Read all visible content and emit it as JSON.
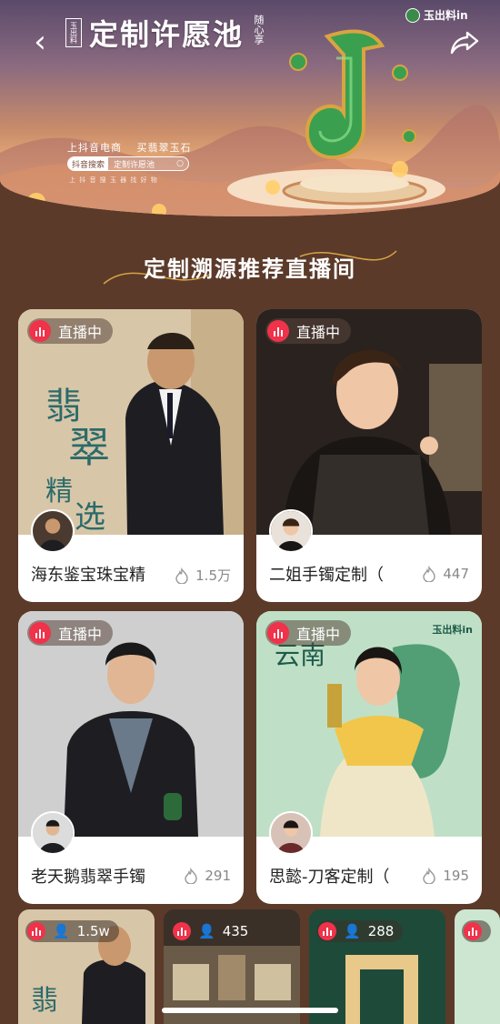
{
  "banner": {
    "seal_text": "玉出料",
    "title": "定制许愿池",
    "subtitle": "随心享",
    "brand": "玉出料in",
    "slogan_left": "上抖音电商",
    "slogan_right": "买翡翠玉石",
    "search_tag": "抖音搜索",
    "search_query": "定制许愿池",
    "fine_print": "上 抖 音   搜 玉 器 找 好 物"
  },
  "section": {
    "title": "定制溯源推荐直播间"
  },
  "live_label": "直播中",
  "cards": [
    {
      "name": "海东鉴宝珠宝精",
      "likes": "1.5万",
      "photo_text": "翡翠精选"
    },
    {
      "name": "二姐手镯定制（",
      "likes": "447"
    },
    {
      "name": "老天鹅翡翠手镯",
      "likes": "291"
    },
    {
      "name": "思懿-刀客定制（",
      "likes": "195",
      "photo_text": "云南",
      "brand": "玉出料in"
    }
  ],
  "bottom_strip": [
    {
      "viewers": "1.5w"
    },
    {
      "viewers": "435"
    },
    {
      "viewers": "288"
    },
    {
      "viewers": ""
    }
  ],
  "colors": {
    "background": "#5b3a2a",
    "live_red": "#f0324a",
    "card_bg": "#ffffff"
  }
}
